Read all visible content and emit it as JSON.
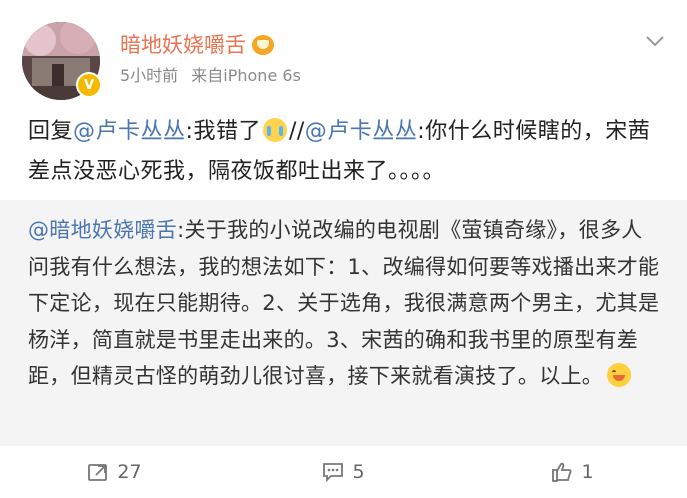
{
  "header": {
    "username": "暗地妖娆嚼舌",
    "time": "5小时前",
    "source": "来自iPhone 6s",
    "avatar_icon": "avatar-photo",
    "verified_icon": "verified-badge-icon",
    "vip_icon": "vip-crown-icon",
    "more_icon": "chevron-down-icon"
  },
  "post": {
    "reply_prefix": "回复",
    "mention1": "@卢卡丛丛",
    "text1": ":我错了",
    "separator": "//",
    "mention2": "@卢卡丛丛",
    "text2": ":你什么时候瞎的，宋茜差点没恶心死我，隔夜饭都吐出来了。。。。"
  },
  "repost": {
    "mention": "@暗地妖娆嚼舌",
    "text": ":关于我的小说改编的电视剧《萤镇奇缘》，很多人问我有什么想法，我的想法如下：1、改编得如何要等戏播出来才能下定论，现在只能期待。2、关于选角，我很满意两个男主，尤其是杨洋，简直就是书里走出来的。3、宋茜的确和我书里的原型有差距，但精灵古怪的萌劲儿很讨喜，接下来就看演技了。以上。"
  },
  "actions": {
    "repost_count": "27",
    "comment_count": "5",
    "like_count": "1"
  },
  "colors": {
    "username": "#eb7350",
    "mention": "#4a76b1",
    "repost_bg": "#f4f4f4",
    "meta": "#8a8a8a"
  }
}
